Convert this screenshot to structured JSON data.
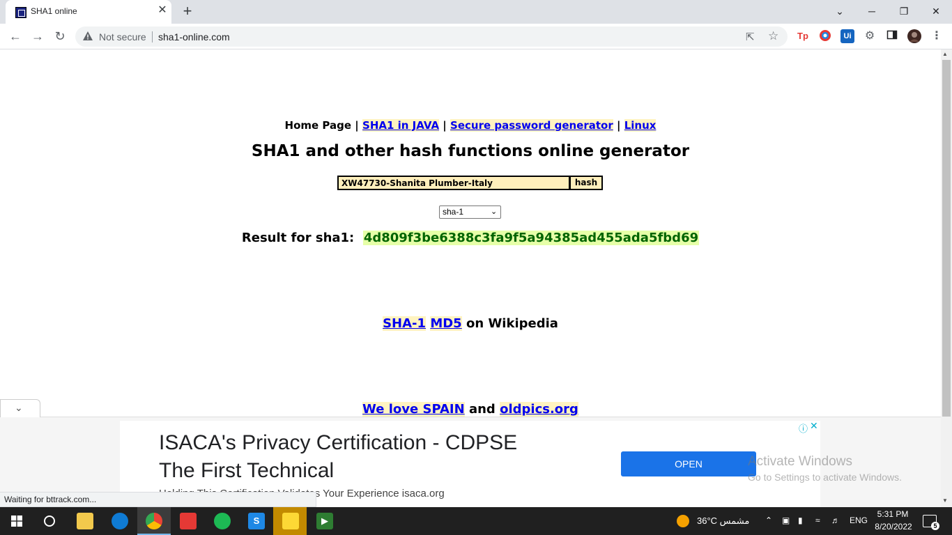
{
  "browser": {
    "tab_title": "SHA1 online",
    "tab_close": "✕",
    "new_tab": "+",
    "window_controls": {
      "minimize": "─",
      "restore": "❐",
      "close": "✕",
      "tab_search": "⌄"
    },
    "security_label": "Not secure",
    "url": "sha1-online.com",
    "extensions": [
      "Tp",
      "color-picker",
      "Ui",
      "puzzle"
    ]
  },
  "page": {
    "nav": {
      "home": "Home Page",
      "sep": "|",
      "links": [
        "SHA1 in JAVA",
        "Secure password generator",
        "Linux"
      ]
    },
    "heading": "SHA1 and other hash functions online generator",
    "input_value": "XW47730-Shanita Plumber-Italy",
    "hash_button": "hash",
    "algorithm": "sha-1",
    "result_label": "Result for sha1:",
    "result_value": "4d809f3be6388c3fa9f5a94385ad455ada5fbd69",
    "wiki": {
      "link1": "SHA-1",
      "link2": "MD5",
      "suffix": "on Wikipedia"
    },
    "spain": {
      "link1": "We love SPAIN",
      "and": "and",
      "link2": "oldpics.org"
    }
  },
  "ad": {
    "title_line1": "ISACA's Privacy Certification - CDPSE",
    "title_line2": "The First Technical",
    "description": "Holding This Certification Validates Your Experience isaca.org",
    "open_button": "OPEN",
    "info": "ⓘ",
    "close": "✕"
  },
  "watermark": {
    "title": "Activate Windows",
    "subtitle": "Go to Settings to activate Windows."
  },
  "status_text": "Waiting for bttrack.com...",
  "taskbar": {
    "weather": "36°C مشمس",
    "language": "ENG",
    "time": "5:31 PM",
    "date": "8/20/2022",
    "notifications": "5"
  },
  "colors": {
    "link": "#0000ee",
    "input_bg": "#ffefbc",
    "result_bg": "#e6ffa8",
    "result_text": "#006400",
    "ad_button": "#1a73e8"
  }
}
